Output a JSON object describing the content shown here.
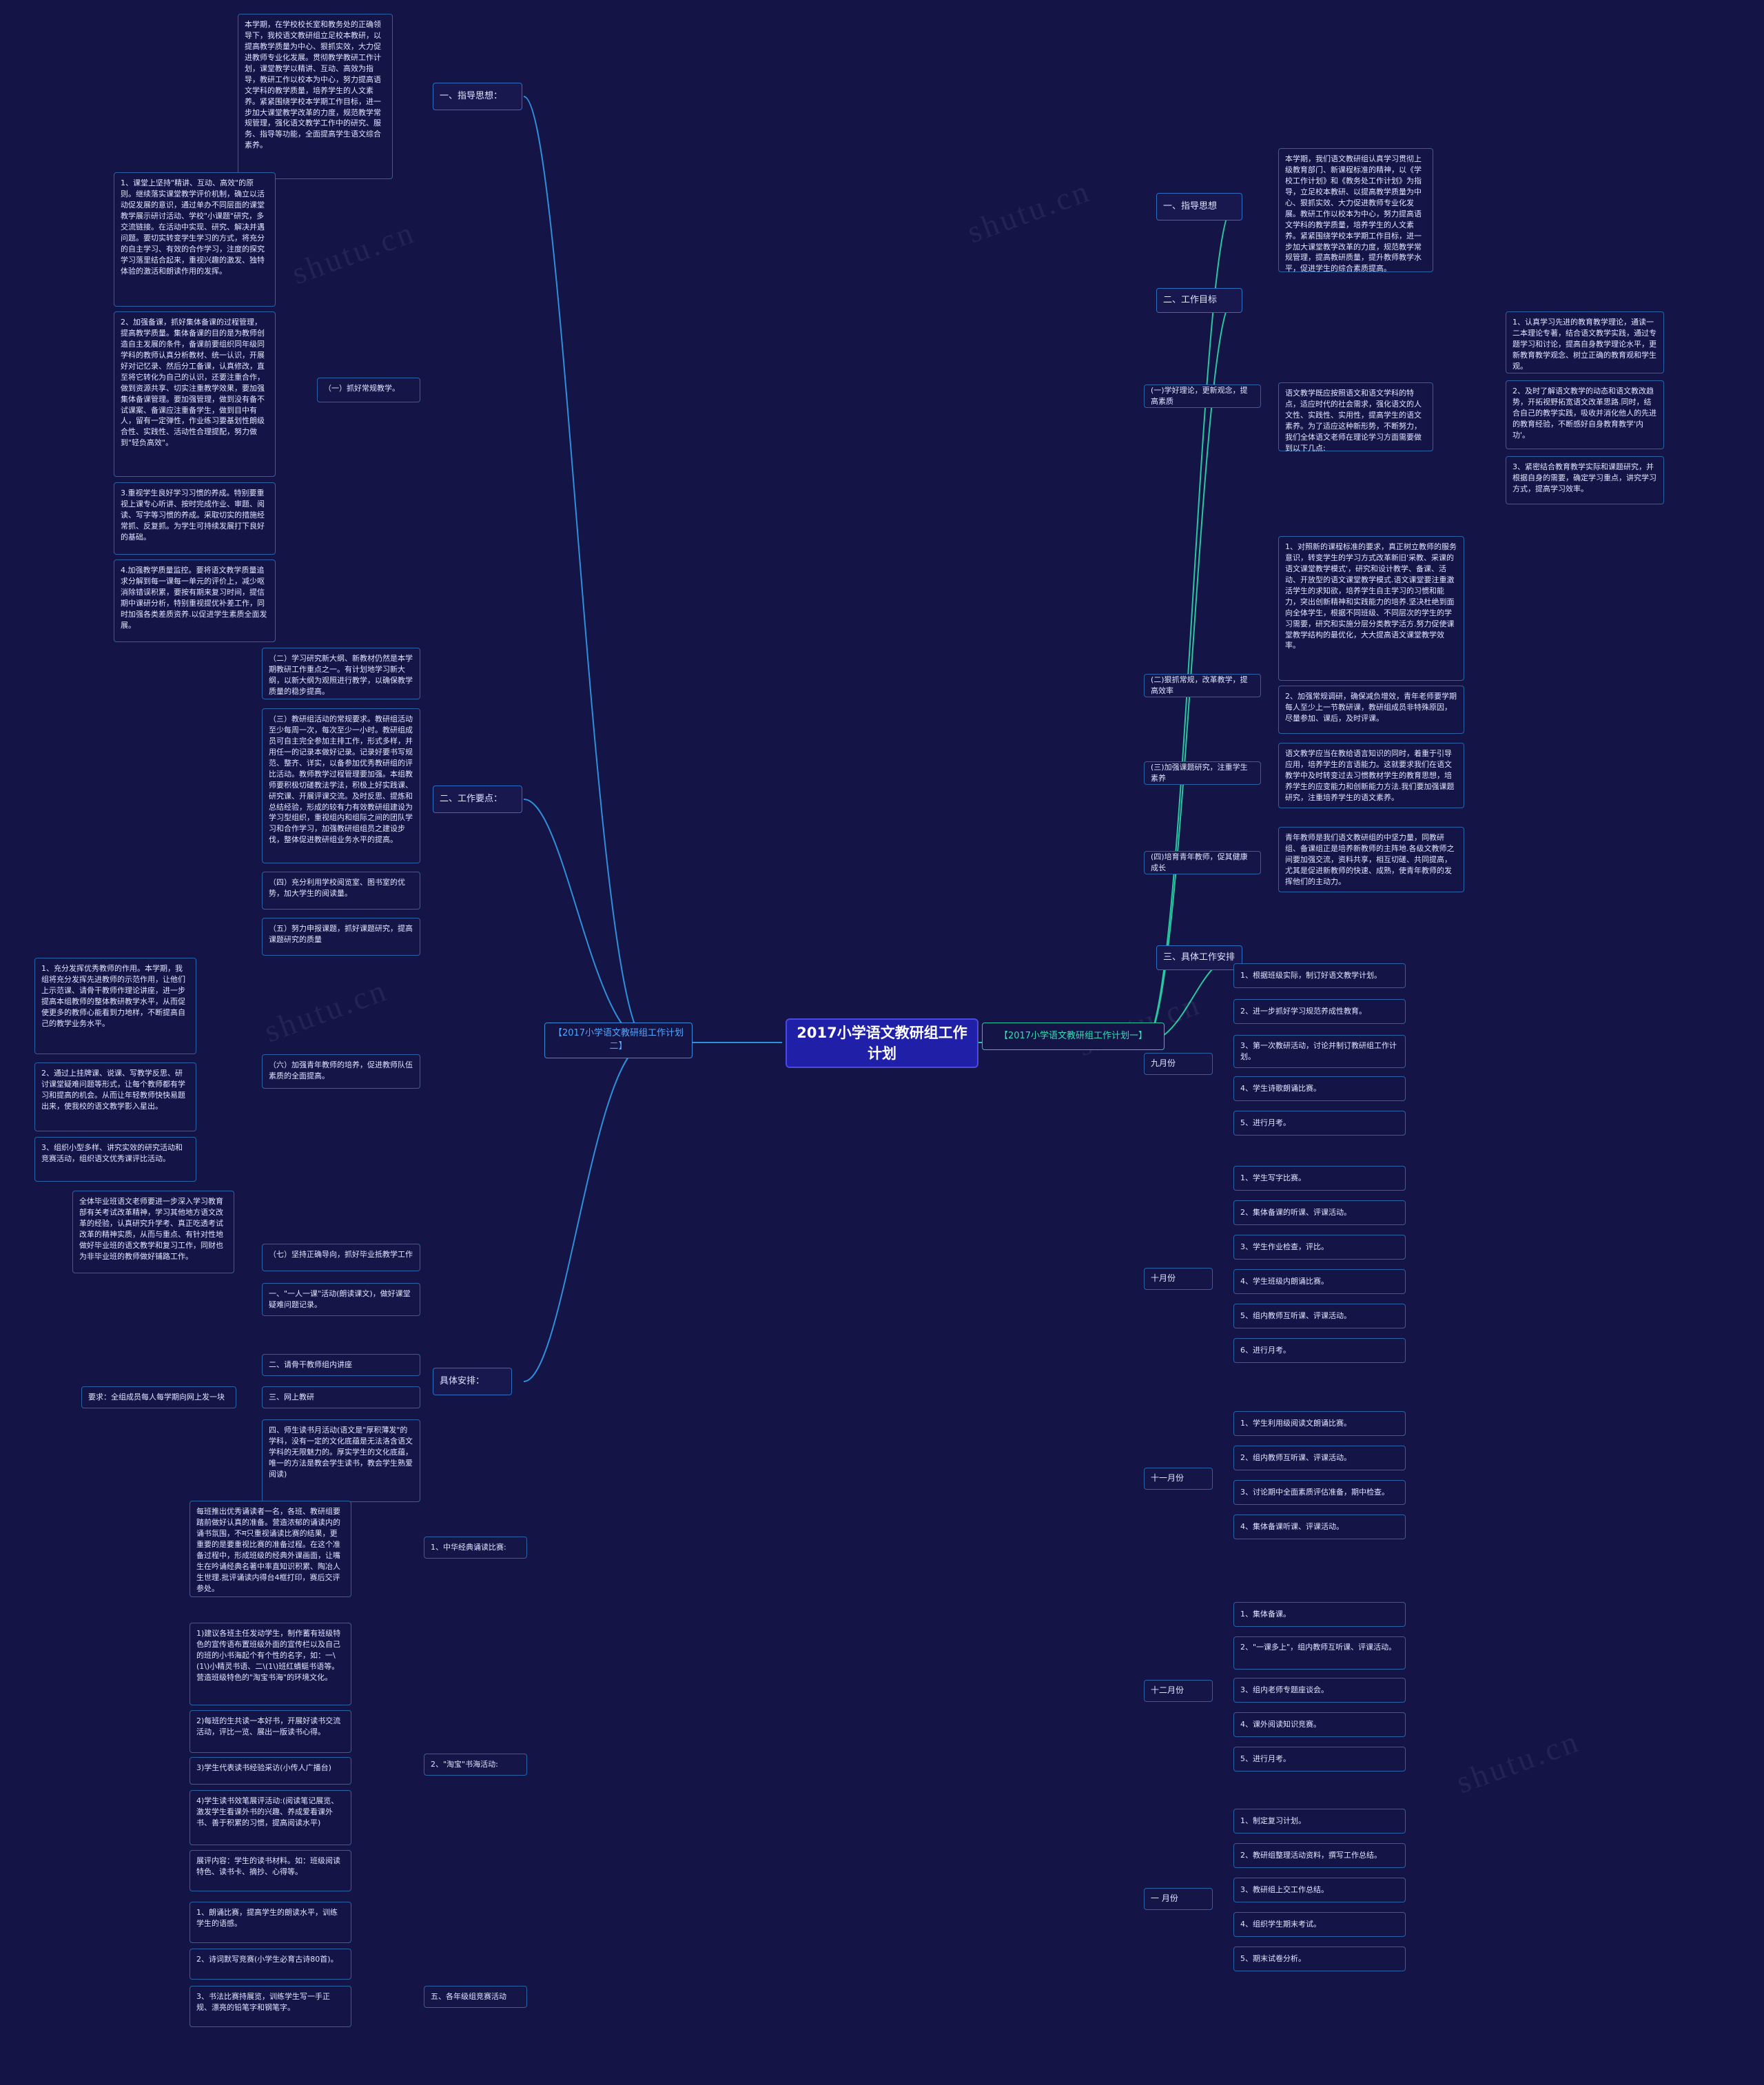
{
  "center": {
    "title": "2017小学语文教研组工作计划"
  },
  "tags": {
    "left": "【2017小学语文教研组工作计划二】",
    "right": "【2017小学语文教研组工作计划一】"
  },
  "left": {
    "branches": [
      {
        "label": "一、指导思想：",
        "leaves": [
          "本学期，在学校校长室和教务处的正确领导下，我校语文教研组立足校本教研，以提高教学质量为中心、狠抓实效，大力促进教师专业化发展。贯彻教学教研工作计划，课堂教学以精讲、互动、高效为指导，教研工作以校本为中心，努力提高语文学科的教学质量，培养学生的人文素养。紧紧围绕学校本学期工作目标，进一步加大课堂教学改革的力度，规范教学常规管理，强化语文教学工作中的研究、服务、指导等功能，全面提高学生语文综合素养。"
        ]
      },
      {
        "label": "二、工作要点：",
        "subs": [
          {
            "label": "（一）抓好常规教学。",
            "leaves": [
              "1、课堂上坚持\"精讲、互动、高效\"的原则。继续落实课堂教学评价机制，确立以活动促发展的意识，通过单办不同层面的课堂教学展示研讨活动、学校\"小课题\"研究，多交流链接。在活动中实现、研究、解决并遇问题。要切实转变学生学习的方式，将充分的自主学习、有效的合作学习，注度的探究学习落里结合起来，重视兴趣的激发、独特体验的激活和朗读作用的发挥。",
              "2、加强备课，抓好集体备课的过程管理，提高教学质量。集体备课的目的是为教师创造自主发展的条件，备课前要组织同年级同学科的教师认真分析教材、统一认识，开展好对记忆录、然后分工备课，认真修改，直至将它转化为自己的认识，还要注重合作，做到资源共享、切实注重教学效果，要加强集体备课管理。要加强管理，做到没有备不试课案、备课应注重备学生，做到目中有人，留有一定弹性，作业练习要基划性朗级合性、实践性、活动性合理提配，努力做到\"轻负高效\"。",
              "3.重视学生良好学习习惯的养成。特别要重视上课专心听讲、按时完成作业、审题、阅读、写字等习惯的养成。采取切实的措施经常抓、反复抓。为学生可持续发展打下良好的基础。",
              "4.加强教学质量监控。要将语文教学质量追求分解到每一课每一单元的评价上，减少呕消除错误积累，要按有期来复习时间，提信期中课研分析，特别重视提优补差工作，同时加强各类差质资养.以促进学生素质全面发展。"
            ]
          },
          {
            "label": "（二）学习研究新大纲、新教材仍然是本学期教研工作重点之一。有计划地学习新大纲，以新大纲为观照进行教学，以确保教学质量的稳步提高。",
            "leaves": []
          },
          {
            "label": "（三）教研组活动的常规要求。教研组活动至少每周一次，每次至少一小时。教研组成员可自主完全参加主排工作，形式多样，并用任一的记录本做好记录。记录好要书写规范、整齐、详实，以备参加优秀教研组的评比活动。教师教学过程管理要加强。本组教师要积极切磋教法学法，积极上好实践课、研究课、开展评课交流。及时反思、提炼和总结经验，形成的较有力有效教研组建设为学习型组织，重视组内和组际之间的团队学习和合作学习，加强教研组组员之建设步伐，整体促进教研组业务水平的提高。",
            "leaves": []
          },
          {
            "label": "（四）充分利用学校阅览室、图书室的优势，加大学生的阅读量。",
            "leaves": []
          },
          {
            "label": "（五）努力申报课题，抓好课题研究，提高课题研究的质量",
            "leaves": []
          },
          {
            "label": "（六）加强青年教师的培养，促进教师队伍素质的全面提高。",
            "leaves": [
              "1、充分发挥优秀教师的作用。本学期，我组将充分发挥先进教师的示范作用，让他们上示范课、请骨干教师作理论讲座，进一步提高本组教师的整体教研教学水平，从而促使更多的教师心能看到力地样，不断提高自己的教学业务水平。",
              "2、通过上挂牌课、说课、写教学反思、研讨课堂疑难问题等形式，让每个教师都有学习和提高的机会。从而让年轻教师快快易题出来，使我校的语文教学影入星出。",
              "3、组织小型多样、讲究实效的研究活动和竞赛活动，组织语文优秀课评比活动。"
            ]
          },
          {
            "label": "（七）坚持正确导向，抓好毕业抵教学工作",
            "leaves": [
              "全体毕业班语文老师要进一步深入学习教育部有关考试改革精神，学习其他地方语文改革的经验，认真研究升学考、真正吃透考试改革的精神实质，从而与重点、有针对性地做好毕业班的语文教学和复习工作，同财也为非毕业班的教师做好铺路工作。"
            ]
          }
        ]
      },
      {
        "label": "具体安排：",
        "subs": [
          {
            "label": "一、\"一人一课\"活动(朗读课文)，做好课堂疑难问题记录。",
            "leaves": []
          },
          {
            "label": "二、请骨干教师组内讲座",
            "leaves": []
          },
          {
            "label": "三、网上教研",
            "leaves": [
              "要求：全组成员每人每学期向网上发一块"
            ]
          },
          {
            "label": "四、师生读书月活动(语文是\"厚积薄发\"的学科，没有一定的文化底蕴是无法洛含语文学科的无限魅力的。厚实学生的文化底蕴，唯一的方法是教会学生读书，教会学生熟爱阅读)",
            "leaves": []
          },
          {
            "label": "1、中华经典诵读比赛:",
            "leaves": [
              "每班推出优秀诵读者一名，各班、教研组要踏前做好认真的准备。营造浓郁的诵读内的诵书氛围，不म只重视诵读比赛的结果，更重要的是要重视比赛的准备过程。在这个准备过程中，形成班级的经典外课画面，让嘴生在吟诵经典名著中率直知识积累、陶冶人生世理.批评诵读内得台4框打印，赛后交评参处。"
            ]
          },
          {
            "label": "2、\"淘宝\"书海活动:",
            "leaves": [
              "1)建议各班主任发动学生，制作蓄有班级特色的宣传语布置班级外面的宣传栏以及自己的班的小书海起个有个性的名字，如：一\\(1\\)小精灵书语、二\\(1\\)班红蜻蜓书语等。营造班级特色的\"淘宝书海\"的环境文化。",
              "2)每班的生共读一本好书，开展好读书交流活动，评比一览、展出一版读书心得。",
              "3)学生代表读书经验采访(小传人广播台)",
              "4)学生读书效笔展评活动:(阅读笔记展览、激发学生看课外书的兴趣、养成爱看课外书、善于积累的习惯，提高阅读水平)",
              "展评内容：学生的读书材料。如：班级阅读特色、读书卡、摘抄、心得等。"
            ]
          },
          {
            "label": "五、各年级组竞赛活动",
            "leaves": [
              "1、朗诵比赛，提高学生的朗读水平，训练学生的语感。",
              "2、诗词默写竞赛(小学生必育古诗80首)。",
              "3、书法比赛持展览，训练学生写一手正规、漂亮的铅笔字和钢笔字。"
            ]
          }
        ]
      }
    ]
  },
  "right": {
    "branches": [
      {
        "label": "一、指导思想",
        "leaves": [
          "本学期，我们语文教研组认真学习贯彻上级教育部门、新课程标准的精神，以《学校工作计划》和《教务处工作计划》为指导，立足校本教研、以提高教学质量为中心、狠抓实效、大力促进教师专业化发展。教研工作以校本为中心，努力提高语文学科的教学质量，培养学生的人文素养。紧紧围绕学校本学期工作目标，进一步加大课堂教学改革的力度，规范教学常规管理，提高教研质量，提升教师教学水平，促进学生的综合素质提高。"
        ]
      },
      {
        "label": "二、工作目标",
        "subs": [
          {
            "label": "(一)学好理论，更新观念，提高素质",
            "leaves": [
              "语文教学既应按照语文和语文学科的特点，适应时代的社会需求，强化语文的人文性、实践性、实用性，提高学生的语文素养。为了适应这种新形势，不断努力，我们全体语文老师在理论学习方面需要做到以下几点:",
              "1、认真学习先进的教育教学理论，通读一二本理论专著，结合语文教学实践，通过专题学习和讨论，提高自身教学理论水平，更新教育教学观念、树立正确的教育观和学生观。",
              "2、及时了解语文教学的动态和语文教改趋势，开拓视野拓宽语文改革思路.同时，结合自己的教学实践，吸收并消化他人的先进的教育经验，不断感好自身教育教学'内功'。",
              "3、紧密结合教育教学实际和课题研究，并根据自身的需要，确定学习重点，讲究学习方式，提高学习效率。"
            ]
          },
          {
            "label": "(二)狠抓常规，改革教学，提高效率",
            "leaves": [
              "1、对照新的课程标准的要求，真正树立教师的服务意识，转变学生的学习方式改革新旧'采教、采课的语文课堂教学模式'，研究和设计教学、备课、活动、开放型的语文课堂教学模式.语文课堂要注重激活学生的求知欲，培养学生自主学习的习惯和能力，突出创新精神和实践能力的培养.坚决杜绝到面向全体学生，根据不同班级、不同层次的学生的学习需要，研究和实施分层分类教学活方.努力促使课堂教学结构的最优化，大大提高语文课堂教学效率。",
              "2、加强常规调研，确保减负增效，青年老师要学期每人至少上一节教研课，教研组成员非特殊原因，尽量参加、课后，及时评课。"
            ]
          },
          {
            "label": "(三)加强课题研究，注重学生素养",
            "leaves": [
              "语文教学应当在教给语言知识的同时，着重于引导应用，培养学生的言语能力。这就要求我们在语文教学中及时转变过去习惯教材学生的教育思想，培养学生的应变能力和创新能力方法.我们要加强课题研究，注重培养学生的语文素养。"
            ]
          },
          {
            "label": "(四)培育青年教师，促其健康成长",
            "leaves": [
              "青年教师是我们语文教研组的中坚力量，同教研组、备课组正是培养新教师的主阵地.各级文教师之间要加强交流，资料共享，相互切磋、共同提高，尤其是促进新教师的快速、成熟，使青年教师的发挥他们的主动力。"
            ]
          }
        ]
      },
      {
        "label": "三、具体工作安排",
        "subs": [
          {
            "label": "九月份",
            "leaves": [
              "1、根据班级实际，制订好语文教学计划。",
              "2、进一步抓好学习规范养成性教育。",
              "3、第一次教研活动，讨论并制订教研组工作计划。",
              "4、学生诗歌朗诵比赛。",
              "5、进行月考。"
            ]
          },
          {
            "label": "十月份",
            "leaves": [
              "1、学生写字比赛。",
              "2、集体备课的听课、评课活动。",
              "3、学生作业检查，评比。",
              "4、学生班级内朗诵比赛。",
              "5、组内教师互听课、评课活动。",
              "6、进行月考。"
            ]
          },
          {
            "label": "十一月份",
            "leaves": [
              "1、学生利用级阅读文朗诵比赛。",
              "2、组内教师互听课、评课活动。",
              "3、讨论期中全面素质评估准备，期中检查。",
              "4、集体备课听课、评课活动。"
            ]
          },
          {
            "label": "十二月份",
            "leaves": [
              "1、集体备课。",
              "2、\"一课多上\"，组内教师互听课、评课活动。",
              "3、组内老师专题座谈会。",
              "4、课外阅读知识竞赛。",
              "5、进行月考。"
            ]
          },
          {
            "label": "一 月份",
            "leaves": [
              "1、制定复习计划。",
              "2、教研组整理活动资料，撰写工作总结。",
              "3、教研组上交工作总结。",
              "4、组织学生期末考试。",
              "5、期末试卷分析。"
            ]
          }
        ]
      }
    ]
  },
  "watermarks": [
    "shutu.cn",
    "shutu.cn",
    "shutu.cn",
    "shutu.cn",
    "shutu.cn",
    "shutu.cn"
  ],
  "colors": {
    "background": "#141447",
    "center": "#1f1fa8",
    "left_accent": "#3a8ad8",
    "right_accent": "#29c7a0"
  }
}
